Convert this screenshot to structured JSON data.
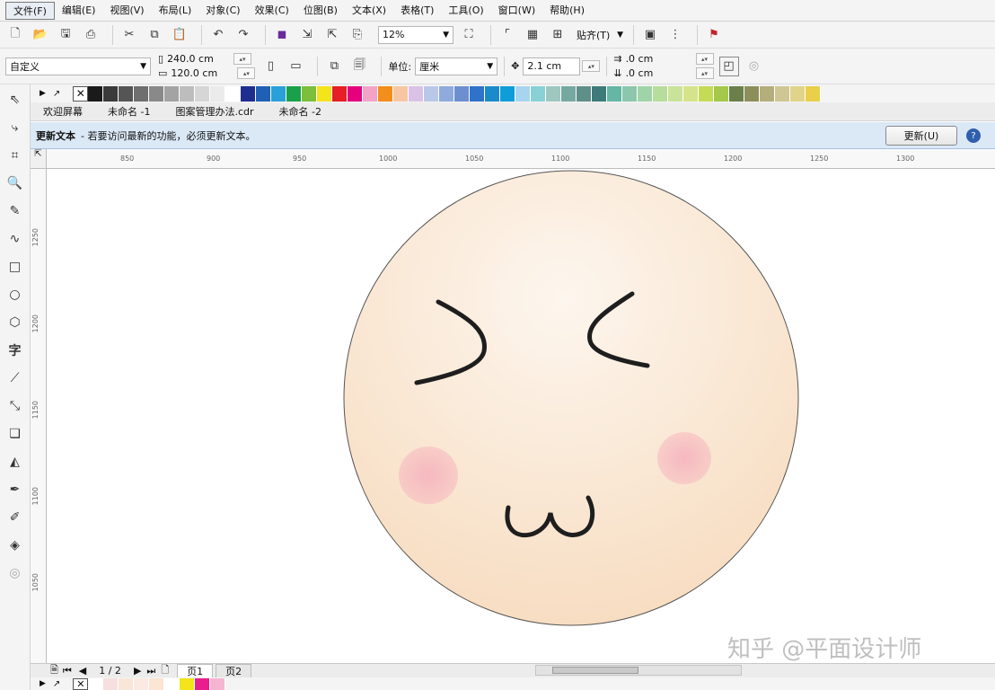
{
  "menu": [
    "文件(F)",
    "编辑(E)",
    "视图(V)",
    "布局(L)",
    "对象(C)",
    "效果(C)",
    "位图(B)",
    "文本(X)",
    "表格(T)",
    "工具(O)",
    "窗口(W)",
    "帮助(H)"
  ],
  "toolbar": {
    "zoom_value": "12%",
    "snap_label": "贴齐(T)"
  },
  "propbar": {
    "paper_preset": "自定义",
    "width": "240.0 cm",
    "height": "120.0 cm",
    "units_label": "单位:",
    "units_value": "厘米",
    "nudge_value": "2.1 cm",
    "dup_x": ".0 cm",
    "dup_y": ".0 cm"
  },
  "palette_colors": [
    "#1a1a1a",
    "#3a3a3a",
    "#555555",
    "#6f6f6f",
    "#898989",
    "#a3a3a3",
    "#bdbdbd",
    "#d6d6d6",
    "#ebebeb",
    "#ffffff",
    "#1e2e8f",
    "#1f60b5",
    "#29a0d8",
    "#1aa04a",
    "#7bbf3a",
    "#f4e41a",
    "#e61e25",
    "#e5007e",
    "#f3a3c8",
    "#f28e1c",
    "#f7c6a3",
    "#d9c2e6",
    "#b9c7e8",
    "#8faadc",
    "#6e8fcf",
    "#2f72c9",
    "#1b8acb",
    "#0f9dd9",
    "#a7d5ef",
    "#8ad1d7",
    "#9ec7c0",
    "#76a8a2",
    "#5f8f89",
    "#3f7a7a",
    "#65b6a5",
    "#8cc6ad",
    "#a0d4a8",
    "#b7dd9c",
    "#c9e39b",
    "#d5e48a",
    "#c4dc55",
    "#a3c84a",
    "#6a7f4a",
    "#8d8f5a",
    "#b4ae7d",
    "#cfc693",
    "#e0d48b",
    "#e9cf4a"
  ],
  "doc_tabs": [
    "欢迎屏幕",
    "未命名 -1",
    "图案管理办法.cdr",
    "未命名 -2"
  ],
  "infobar": {
    "title": "更新文本",
    "message": "-  若要访问最新的功能，必须更新文本。",
    "button": "更新(U)",
    "help": "?"
  },
  "ruler_top": [
    "850",
    "900",
    "950",
    "1000",
    "1050",
    "1100",
    "1150",
    "1200",
    "1250",
    "1300"
  ],
  "ruler_left": [
    "1250",
    "1200",
    "1150",
    "1100",
    "1050"
  ],
  "canvas": {
    "face_fill_center": "#fdf6ee",
    "face_fill_edge": "#f7dcc0",
    "face_stroke": "#555555",
    "blush": "#f6b8bf",
    "features_stroke": "#1e1e1e"
  },
  "pager": {
    "position": "1 / 2",
    "pages": [
      "页1",
      "页2"
    ]
  },
  "status_palette": [
    "#ffffff",
    "#f7dfe0",
    "#f9e6d9",
    "#fbe9e2",
    "#fce5d3",
    "#ffffff",
    "#f4e41a",
    "#e91e8c",
    "#f5b5d0"
  ],
  "watermark": "知乎 @平面设计师"
}
